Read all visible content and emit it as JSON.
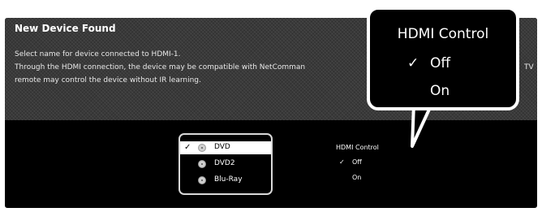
{
  "dialog": {
    "title": "New Device Found",
    "lines": [
      "Select name for device connected to HDMI-1.",
      "Through the HDMI connection, the device may be compatible with NetComman",
      "remote may control the device without IR learning."
    ],
    "tv_fragment": "TV"
  },
  "device_list": {
    "items": [
      {
        "label": "DVD",
        "selected": true,
        "check": "✓",
        "icon": "disc-icon"
      },
      {
        "label": "DVD2",
        "selected": false,
        "check": "",
        "icon": "disc-icon"
      },
      {
        "label": "Blu-Ray",
        "selected": false,
        "check": "",
        "icon": "disc-icon"
      }
    ]
  },
  "hdmi_control": {
    "title": "HDMI Control",
    "options": [
      {
        "label": "Off",
        "check": "✓",
        "selected": true
      },
      {
        "label": "On",
        "check": "",
        "selected": false
      }
    ]
  },
  "colors": {
    "background": "#000000",
    "header_pattern": "#3a3a3a",
    "text": "#ffffff",
    "highlight": "#ffffff"
  }
}
